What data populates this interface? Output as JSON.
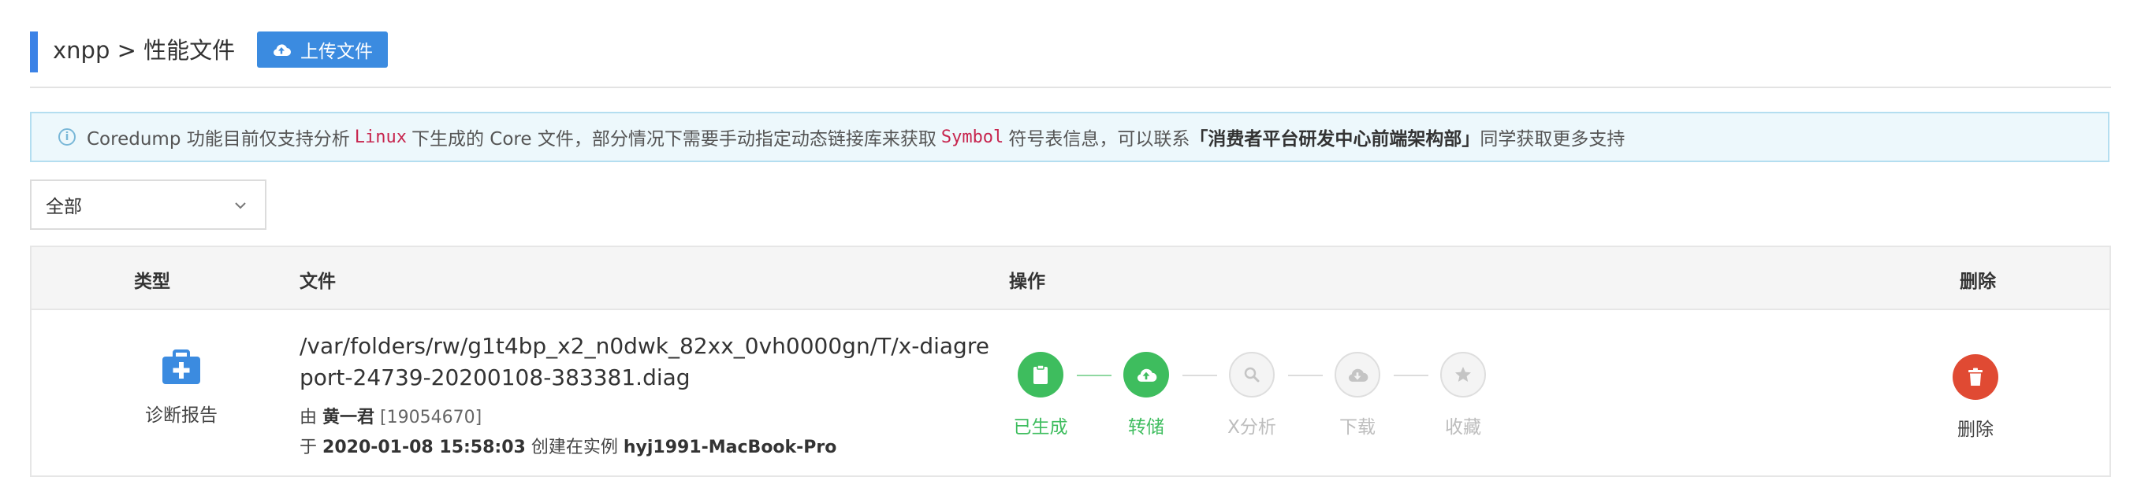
{
  "header": {
    "title": "xnpp > 性能文件",
    "upload_label": "上传文件"
  },
  "notice": {
    "part1": "Coredump 功能目前仅支持分析",
    "code1": "Linux",
    "part2": "下生成的 Core 文件，部分情况下需要手动指定动态链接库来获取",
    "code2": "Symbol",
    "part3": "符号表信息，可以联系",
    "bold": "「消费者平台研发中心前端架构部」",
    "part4": "同学获取更多支持"
  },
  "filter": {
    "selected": "全部"
  },
  "table": {
    "columns": {
      "type": "类型",
      "file": "文件",
      "ops": "操作",
      "delete": "删除"
    },
    "rows": [
      {
        "type_label": "诊断报告",
        "path": "/var/folders/rw/g1t4bp_x2_n0dwk_82xx_0vh0000gn/T/x-diagreport-24739-20200108-383381.diag",
        "by_prefix": "由",
        "user": "黄一君",
        "user_id": "[19054670]",
        "at_prefix": "于",
        "time": "2020-01-08 15:58:03",
        "created_text": "创建在实例",
        "instance": "hyj1991-MacBook-Pro",
        "steps": [
          {
            "label": "已生成",
            "icon": "clipboard-icon",
            "state": "done"
          },
          {
            "label": "转储",
            "icon": "cloud-upload-icon",
            "state": "done"
          },
          {
            "label": "X分析",
            "icon": "search-icon",
            "state": "disabled"
          },
          {
            "label": "下载",
            "icon": "cloud-download-icon",
            "state": "disabled"
          },
          {
            "label": "收藏",
            "icon": "star-icon",
            "state": "disabled"
          }
        ],
        "delete_label": "删除"
      }
    ]
  },
  "colors": {
    "accent": "#3b82e6",
    "success": "#3ebd5e",
    "danger": "#e04a33",
    "notice_bg": "#edf8fc",
    "code": "#c7254e"
  }
}
